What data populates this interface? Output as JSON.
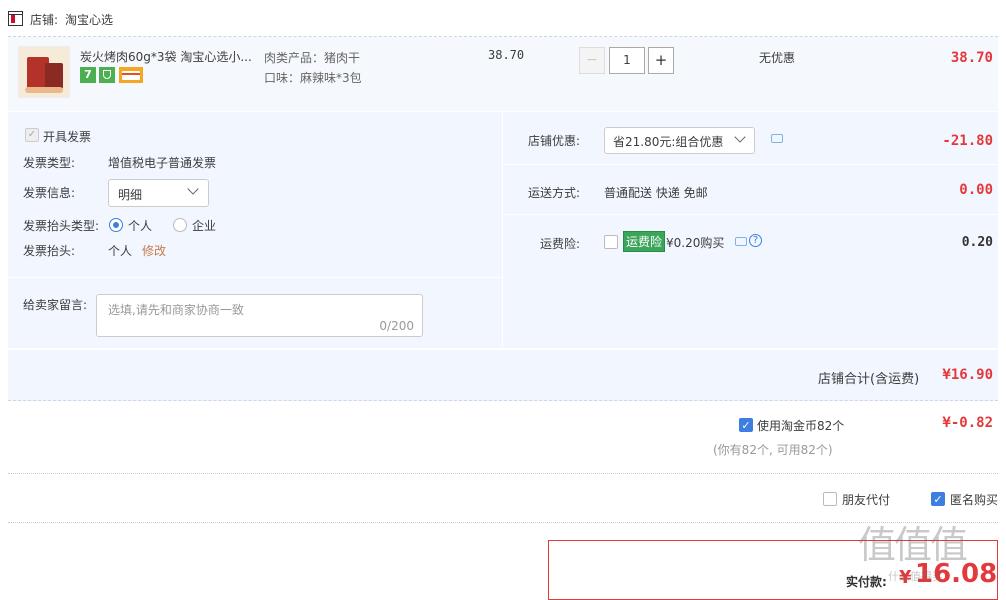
{
  "shop": {
    "label": "店铺:",
    "name": "淘宝心选"
  },
  "product": {
    "title": "炭火烤肉60g*3袋 淘宝心选小...",
    "badge_seven": "7",
    "sku": {
      "meat_type": "肉类产品：猪肉干",
      "flavor": "口味：麻辣味*3包"
    },
    "unit_price": "38.70",
    "quantity": "1",
    "minus": "−",
    "plus": "+",
    "promo": "无优惠",
    "subtotal": "38.70"
  },
  "invoice": {
    "issue_label": "开具发票",
    "type_label": "发票类型:",
    "type_value": "增值税电子普通发票",
    "info_label": "发票信息:",
    "info_value": "明细",
    "title_type_label": "发票抬头类型:",
    "title_type_options": [
      "个人",
      "企业"
    ],
    "title_label": "发票抬头:",
    "title_value": "个人",
    "modify": "修改"
  },
  "message": {
    "label": "给卖家留言:",
    "placeholder": "选填,请先和商家协商一致",
    "counter": "0/200"
  },
  "shop_discount": {
    "label": "店铺优惠:",
    "value": "省21.80元:组合优惠",
    "amount": "-21.80"
  },
  "delivery": {
    "label": "运送方式:",
    "value": "普通配送 快递 免邮",
    "amount": "0.00"
  },
  "freight_insurance": {
    "label": "运费险:",
    "tag": "运费险",
    "price": "¥0.20购买",
    "help": "?",
    "amount": "0.20"
  },
  "shop_total": {
    "label": "店铺合计(含运费)",
    "amount": "¥16.90"
  },
  "coins": {
    "label": "使用淘金币82个",
    "note": "(你有82个, 可用82个)",
    "amount": "¥-0.82"
  },
  "options": {
    "friend_pay": "朋友代付",
    "anonymous": "匿名购买"
  },
  "final": {
    "label": "实付款:",
    "currency": "¥",
    "amount": "16.08"
  },
  "watermark": {
    "text": "值值值",
    "sub": "什么值得买"
  },
  "colors": {
    "accent": "#e4393c",
    "blue": "#3d7ee0",
    "panel": "#f2f7ff",
    "tag_green": "#4caf50"
  }
}
